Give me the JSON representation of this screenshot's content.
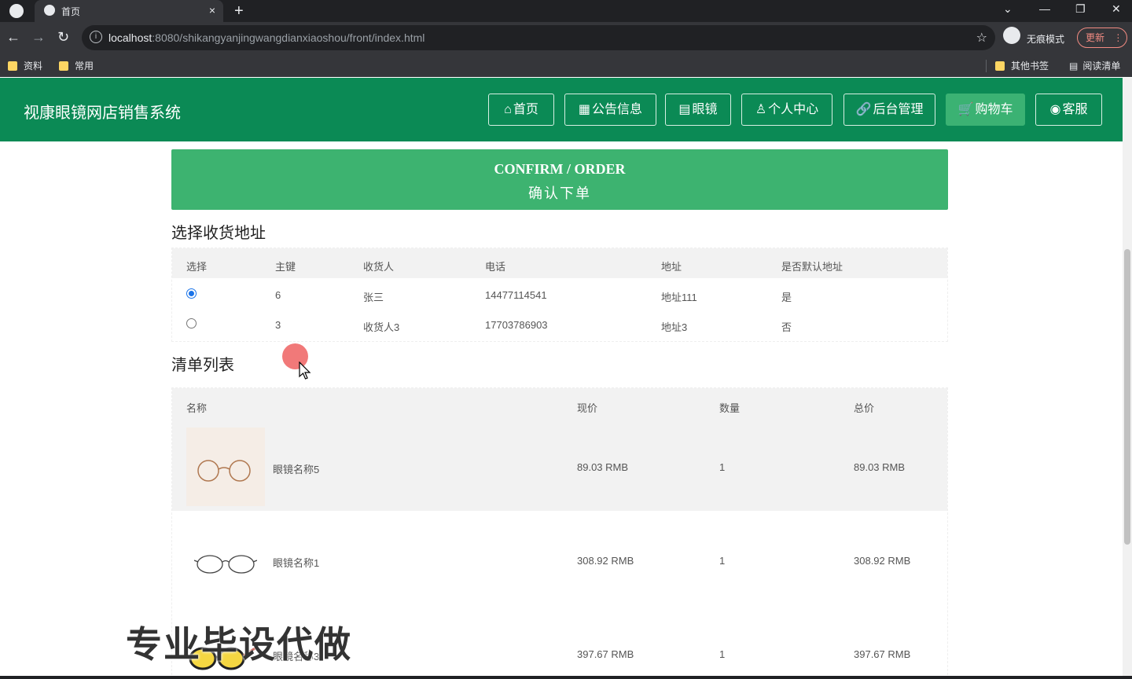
{
  "browser": {
    "tab_title": "首页",
    "tab_close": "×",
    "new_tab": "+",
    "url_host": "localhost",
    "url_rest": ":8080/shikangyanjingwangdianxiaoshou/front/index.html",
    "incognito_label": "无痕模式",
    "update_label": "更新",
    "bookmarks": [
      "资料",
      "常用"
    ],
    "other_bookmarks": "其他书签",
    "reading_list": "阅读清单"
  },
  "site": {
    "title": "视康眼镜网店销售系统",
    "nav": [
      {
        "icon": "⌂",
        "label": "首页"
      },
      {
        "icon": "▦",
        "label": "公告信息"
      },
      {
        "icon": "▤",
        "label": "眼镜"
      },
      {
        "icon": "♙",
        "label": "个人中心"
      },
      {
        "icon": "🔗",
        "label": "后台管理"
      },
      {
        "icon": "🛒",
        "label": "购物车"
      },
      {
        "icon": "◉",
        "label": "客服"
      }
    ],
    "active_nav": "购物车",
    "brand_color": "#0b8a55",
    "accent_color": "#3db370"
  },
  "banner": {
    "en": "CONFIRM / ORDER",
    "zh": "确认下单"
  },
  "address_section": {
    "title": "选择收货地址",
    "columns": [
      "选择",
      "主键",
      "收货人",
      "电话",
      "地址",
      "是否默认地址"
    ],
    "rows": [
      {
        "selected": true,
        "id": "6",
        "name": "张三",
        "phone": "14477114541",
        "address": "地址111",
        "default": "是"
      },
      {
        "selected": false,
        "id": "3",
        "name": "收货人3",
        "phone": "17703786903",
        "address": "地址3",
        "default": "否"
      }
    ]
  },
  "list_section": {
    "title": "清单列表",
    "columns": [
      "名称",
      "现价",
      "数量",
      "总价"
    ],
    "items": [
      {
        "name": "眼镜名称5",
        "price": "89.03 RMB",
        "qty": "1",
        "total": "89.03 RMB"
      },
      {
        "name": "眼镜名称1",
        "price": "308.92 RMB",
        "qty": "1",
        "total": "308.92 RMB"
      },
      {
        "name": "眼镜名称3",
        "price": "397.67 RMB",
        "qty": "1",
        "total": "397.67 RMB"
      }
    ]
  },
  "watermark": "专业毕设代做"
}
